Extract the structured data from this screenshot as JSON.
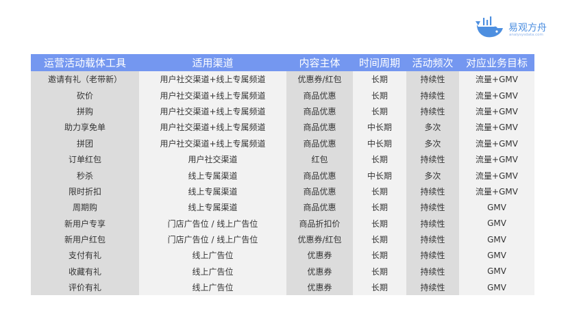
{
  "logo": {
    "name": "易观方舟",
    "url": "analysysdata.com",
    "icon": "whale-icon",
    "color": "#4d8fe0"
  },
  "table": {
    "header_color": "#7497f0",
    "headers": [
      "运营活动载体工具",
      "适用渠道",
      "内容主体",
      "时间周期",
      "活动频次",
      "对应业务目标"
    ],
    "rows": [
      [
        "邀请有礼（老带新）",
        "用户社交渠道+线上专属频道",
        "优惠券/红包",
        "长期",
        "持续性",
        "流量+GMV"
      ],
      [
        "砍价",
        "用户社交渠道+线上专属频道",
        "商品优惠",
        "长期",
        "持续性",
        "流量+GMV"
      ],
      [
        "拼购",
        "用户社交渠道+线上专属频道",
        "商品优惠",
        "长期",
        "持续性",
        "流量+GMV"
      ],
      [
        "助力享免单",
        "用户社交渠道+线上专属频道",
        "商品优惠",
        "中长期",
        "多次",
        "流量+GMV"
      ],
      [
        "拼团",
        "用户社交渠道+线上专属频道",
        "商品优惠",
        "中长期",
        "多次",
        "流量+GMV"
      ],
      [
        "订单红包",
        "用户社交渠道",
        "红包",
        "长期",
        "持续性",
        "流量+GMV"
      ],
      [
        "秒杀",
        "线上专属渠道",
        "商品优惠",
        "中长期",
        "多次",
        "流量+GMV"
      ],
      [
        "限时折扣",
        "线上专属渠道",
        "商品优惠",
        "长期",
        "持续性",
        "流量+GMV"
      ],
      [
        "周期购",
        "线上专属渠道",
        "商品优惠",
        "长期",
        "持续性",
        "GMV"
      ],
      [
        "新用户专享",
        "门店广告位 / 线上广告位",
        "商品折扣价",
        "长期",
        "持续性",
        "GMV"
      ],
      [
        "新用户红包",
        "门店广告位 / 线上广告位",
        "优惠券/红包",
        "长期",
        "持续性",
        "GMV"
      ],
      [
        "支付有礼",
        "线上广告位",
        "优惠券",
        "长期",
        "持续性",
        "GMV"
      ],
      [
        "收藏有礼",
        "线上广告位",
        "优惠券",
        "长期",
        "持续性",
        "GMV"
      ],
      [
        "评价有礼",
        "线上广告位",
        "优惠券",
        "长期",
        "持续性",
        "GMV"
      ]
    ]
  }
}
